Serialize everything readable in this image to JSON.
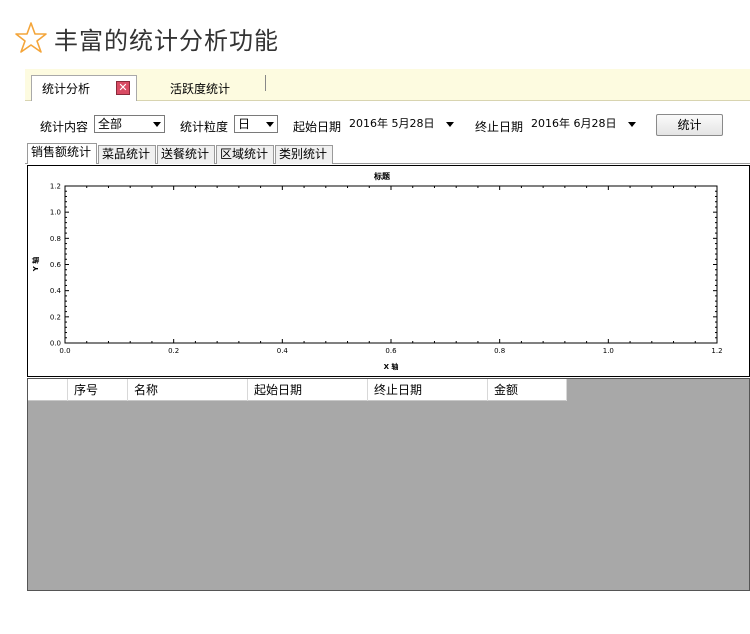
{
  "banner": {
    "title": "丰富的统计分析功能",
    "icon": "star-outline-icon",
    "icon_color": "#f4a53a"
  },
  "doc_tabs": [
    {
      "label": "统计分析",
      "active": true
    },
    {
      "label": "活跃度统计",
      "active": false
    }
  ],
  "toolbar": {
    "content_label": "统计内容",
    "content_value": "全部",
    "granularity_label": "统计粒度",
    "granularity_value": "日",
    "start_label": "起始日期",
    "start_value": "2016年 5月28日",
    "end_label": "终止日期",
    "end_value": "2016年 6月28日",
    "stat_button": "统计"
  },
  "sub_tabs": [
    "销售额统计",
    "菜品统计",
    "送餐统计",
    "区域统计",
    "类别统计"
  ],
  "chart_data": {
    "type": "line",
    "title": "标题",
    "xlabel": "X 轴",
    "ylabel": "Y 轴",
    "xlim": [
      0.0,
      1.2
    ],
    "ylim": [
      0.0,
      1.2
    ],
    "x_ticks": [
      "0.0",
      "0.2",
      "0.4",
      "0.6",
      "0.8",
      "1.0",
      "1.2"
    ],
    "y_ticks": [
      "0.0",
      "0.2",
      "0.4",
      "0.6",
      "0.8",
      "1.0",
      "1.2"
    ],
    "series": []
  },
  "table": {
    "columns": [
      "序号",
      "名称",
      "起始日期",
      "终止日期",
      "金额"
    ],
    "rows": []
  }
}
